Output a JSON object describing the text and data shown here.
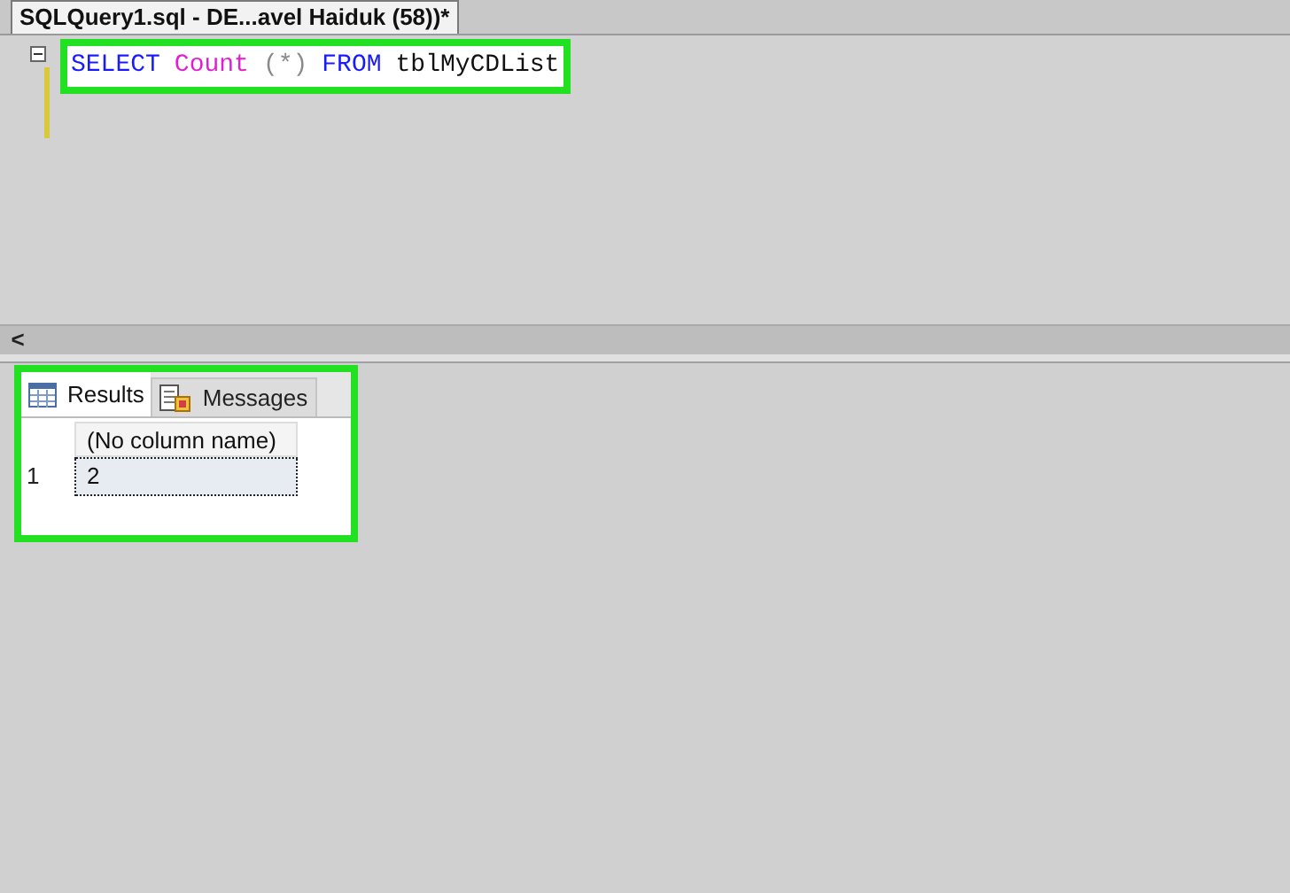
{
  "document_tab": {
    "title": "SQLQuery1.sql - DE...avel Haiduk (58))*"
  },
  "editor": {
    "highlighted": true,
    "tokens": [
      {
        "text": "SELECT",
        "kind": "keyword"
      },
      {
        "text": "Count",
        "kind": "function"
      },
      {
        "text": "(*)",
        "kind": "operator"
      },
      {
        "text": "FROM",
        "kind": "keyword"
      },
      {
        "text": "tblMyCDList",
        "kind": "identifier"
      }
    ]
  },
  "scrollbar": {
    "left_arrow": "<"
  },
  "results": {
    "highlighted": true,
    "tabs": [
      {
        "label": "Results",
        "selected": true,
        "kind": "grid"
      },
      {
        "label": "Messages",
        "selected": false,
        "kind": "messages"
      }
    ],
    "columns": [
      "(No column name)"
    ],
    "rows": [
      {
        "number": "1",
        "cells": [
          "2"
        ],
        "selected": true
      }
    ]
  }
}
